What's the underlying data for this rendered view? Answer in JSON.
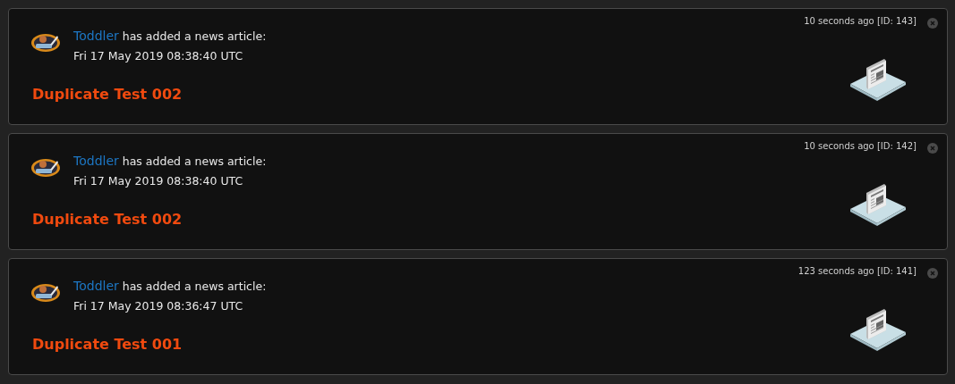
{
  "notifications": [
    {
      "user": "Toddler",
      "action": "has added a news article:",
      "date": "Fri 17 May 2019 08:38:40 UTC",
      "title": "Duplicate Test 002",
      "meta": "10 seconds ago [ID: 143]"
    },
    {
      "user": "Toddler",
      "action": "has added a news article:",
      "date": "Fri 17 May 2019 08:38:40 UTC",
      "title": "Duplicate Test 002",
      "meta": "10 seconds ago [ID: 142]"
    },
    {
      "user": "Toddler",
      "action": "has added a news article:",
      "date": "Fri 17 May 2019 08:36:47 UTC",
      "title": "Duplicate Test 001",
      "meta": "123 seconds ago [ID: 141]"
    }
  ]
}
